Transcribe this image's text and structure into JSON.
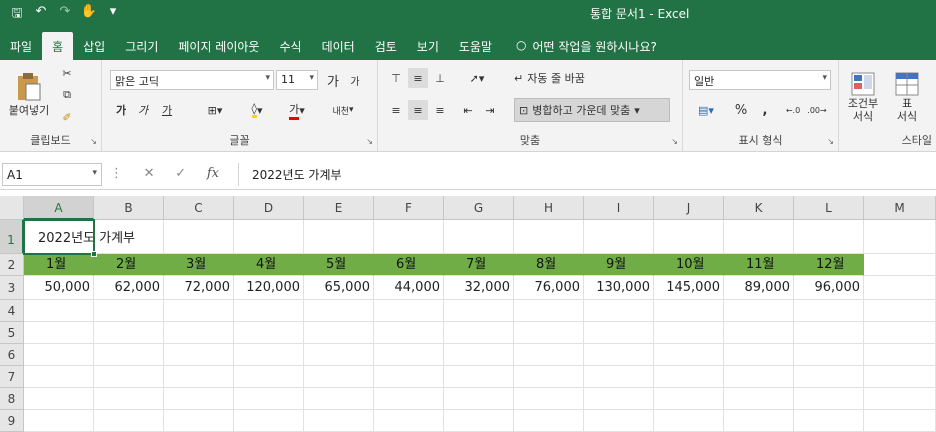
{
  "titlebar": {
    "title": "통합 문서1 - Excel"
  },
  "tabs": [
    "파일",
    "홈",
    "삽입",
    "그리기",
    "페이지 레이아웃",
    "수식",
    "데이터",
    "검토",
    "보기",
    "도움말"
  ],
  "tellme": "어떤 작업을 원하시나요?",
  "clipboard": {
    "paste": "붙여넣기",
    "label": "클립보드"
  },
  "font": {
    "family": "맑은 고딕",
    "size": "11",
    "grow": "가",
    "shrink": "가",
    "bold": "가",
    "italic": "가",
    "underline": "가",
    "color": "가",
    "phonetic": "내천",
    "label": "글꼴"
  },
  "align": {
    "wrap": "자동 줄 바꿈",
    "merge": "병합하고 가운데 맞춤",
    "label": "맞춤"
  },
  "number": {
    "format": "일반",
    "percent": "%",
    "comma": ",",
    "label": "표시 형식"
  },
  "styles": {
    "cond": "조건부 서식",
    "cond1": "조건부",
    "cond2": "서식",
    "table1": "표",
    "table2": "서식",
    "label": "스타일"
  },
  "formula": {
    "namebox": "A1",
    "content": "2022년도 가계부"
  },
  "grid": {
    "columns": [
      "A",
      "B",
      "C",
      "D",
      "E",
      "F",
      "G",
      "H",
      "I",
      "J",
      "K",
      "L",
      "M"
    ],
    "rows": [
      "1",
      "2",
      "3",
      "4",
      "5",
      "6",
      "7",
      "8",
      "9"
    ],
    "a1": "2022년도 가계부",
    "months": [
      "1월",
      "2월",
      "3월",
      "4월",
      "5월",
      "6월",
      "7월",
      "8월",
      "9월",
      "10월",
      "11월",
      "12월"
    ],
    "values": [
      "50,000",
      "62,000",
      "72,000",
      "120,000",
      "65,000",
      "44,000",
      "32,000",
      "76,000",
      "130,000",
      "145,000",
      "89,000",
      "96,000"
    ]
  },
  "colors": {
    "brand": "#217346",
    "header_fill": "#70ad47"
  }
}
